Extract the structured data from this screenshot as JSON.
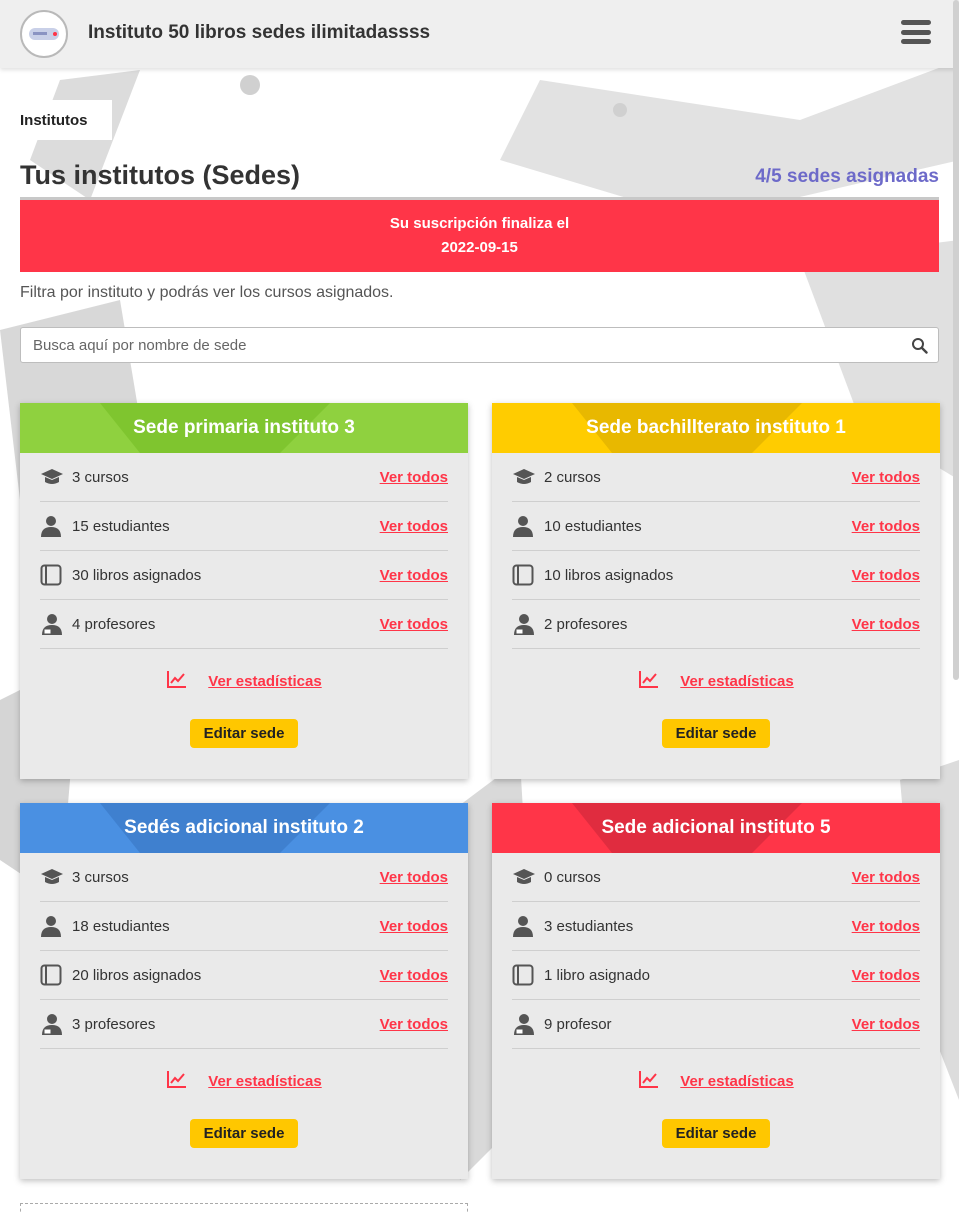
{
  "app": {
    "title": "Instituto 50 libros sedes ilimitadassss"
  },
  "breadcrumb": "Institutos",
  "page": {
    "title": "Tus institutos (Sedes)",
    "sedes_count": "4/5 sedes asignadas"
  },
  "alert": {
    "line1": "Su suscripción finaliza el",
    "line2": "2022-09-15"
  },
  "filter_hint": "Filtra por instituto y podrás ver los cursos asignados.",
  "search": {
    "placeholder": "Busca aquí por nombre de sede",
    "value": ""
  },
  "colors": {
    "alert_red": "#ff3548",
    "link_red": "#ff3548",
    "count_purple": "#6d6ac9",
    "button_yellow": "#ffc700",
    "green": "#8fd13f",
    "yellow": "#ffcc00",
    "blue": "#4a90e2",
    "red": "#ff3548"
  },
  "cards": [
    {
      "name": "Sede primaria instituto 3",
      "color": "#8fd13f",
      "stripe": "#7fc52f",
      "cursos": "3 cursos",
      "estudiantes": "15 estudiantes",
      "libros": "30 libros asignados",
      "profesores": "4 profesores",
      "link": "Ver todos",
      "stats": "Ver estadísticas",
      "edit": "Editar sede"
    },
    {
      "name": "Sede bachillterato instituto 1",
      "color": "#ffcc00",
      "stripe": "#e8b800",
      "cursos": "2 cursos",
      "estudiantes": "10 estudiantes",
      "libros": "10 libros asignados",
      "profesores": "2 profesores",
      "link": "Ver todos",
      "stats": "Ver estadísticas",
      "edit": "Editar sede"
    },
    {
      "name": "Sedés adicional instituto 2",
      "color": "#4a90e2",
      "stripe": "#3f80cf",
      "cursos": "3 cursos",
      "estudiantes": "18 estudiantes",
      "libros": "20 libros asignados",
      "profesores": "3 profesores",
      "link": "Ver todos",
      "stats": "Ver estadísticas",
      "edit": "Editar sede"
    },
    {
      "name": "Sede adicional instituto 5",
      "color": "#ff3548",
      "stripe": "#e02c3f",
      "cursos": "0 cursos",
      "estudiantes": "3 estudiantes",
      "libros": "1 libro asignado",
      "profesores": "9 profesor",
      "link": "Ver todos",
      "stats": "Ver estadísticas",
      "edit": "Editar sede"
    }
  ]
}
